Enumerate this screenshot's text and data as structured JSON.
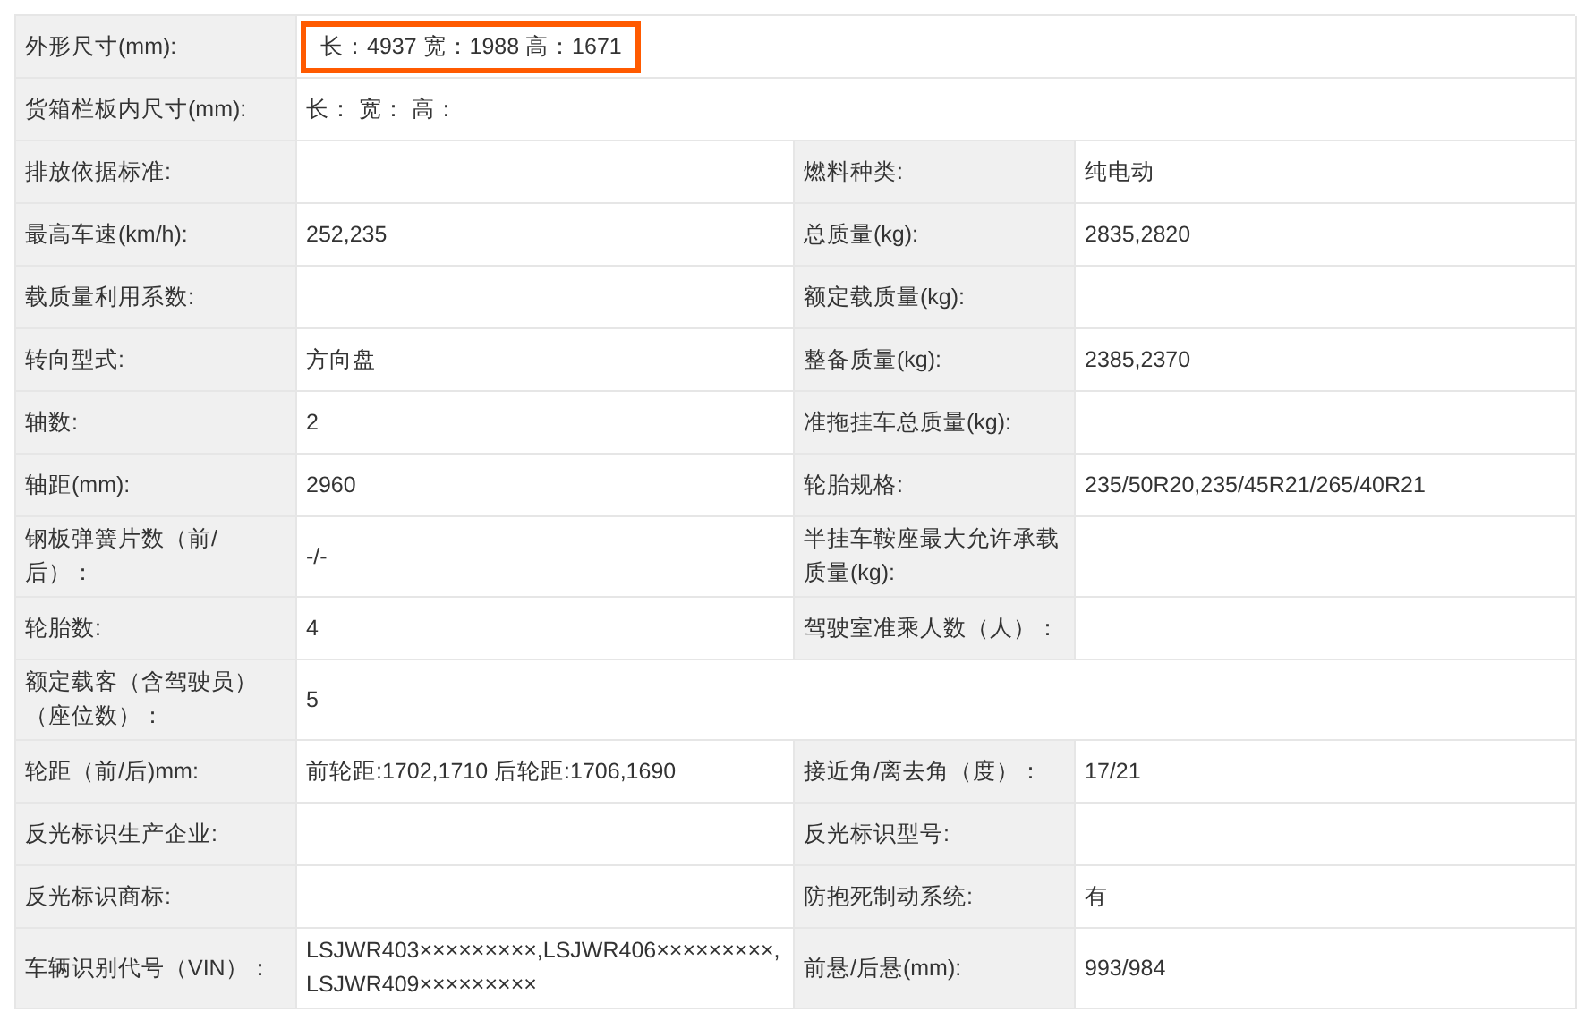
{
  "spec_table": {
    "rows": [
      {
        "fields": [
          {
            "label": "外形尺寸(mm):",
            "value": "长：4937 宽：1988 高：1671",
            "highlighted": true
          }
        ]
      },
      {
        "fields": [
          {
            "label": "货箱栏板内尺寸(mm):",
            "value": "长： 宽： 高：",
            "highlighted": false
          }
        ]
      },
      {
        "fields": [
          {
            "label": "排放依据标准:",
            "highlighted": false
          },
          {
            "label": "燃料种类:",
            "value": "纯电动",
            "highlighted": false
          }
        ]
      },
      {
        "fields": [
          {
            "label": "最高车速(km/h):",
            "value": "252,235",
            "highlighted": false
          },
          {
            "label": "总质量(kg):",
            "value": "2835,2820",
            "highlighted": false
          }
        ]
      },
      {
        "fields": [
          {
            "label": "载质量利用系数:",
            "highlighted": false
          },
          {
            "label": "额定载质量(kg):",
            "highlighted": false
          }
        ]
      },
      {
        "fields": [
          {
            "label": "转向型式:",
            "value": "方向盘",
            "highlighted": false
          },
          {
            "label": "整备质量(kg):",
            "value": "2385,2370",
            "highlighted": false
          }
        ]
      },
      {
        "fields": [
          {
            "label": "轴数:",
            "value": "2",
            "highlighted": false
          },
          {
            "label": "准拖挂车总质量(kg):",
            "highlighted": false
          }
        ]
      },
      {
        "fields": [
          {
            "label": "轴距(mm):",
            "value": "2960",
            "highlighted": false
          },
          {
            "label": "轮胎规格:",
            "value": "235/50R20,235/45R21/265/40R21",
            "highlighted": false
          }
        ]
      },
      {
        "fields": [
          {
            "label": "钢板弹簧片数（前/后）：",
            "value": "-/-",
            "highlighted": false
          },
          {
            "label": "半挂车鞍座最大允许承载质量(kg):",
            "highlighted": false
          }
        ]
      },
      {
        "fields": [
          {
            "label": "轮胎数:",
            "value": "4",
            "highlighted": false
          },
          {
            "label": "驾驶室准乘人数（人）：",
            "highlighted": false
          }
        ]
      },
      {
        "fields": [
          {
            "label": "额定载客（含驾驶员）（座位数）：",
            "value": "5",
            "highlighted": false
          }
        ]
      },
      {
        "fields": [
          {
            "label": "轮距（前/后)mm:",
            "value": "前轮距:1702,1710 后轮距:1706,1690",
            "highlighted": false
          },
          {
            "label": "接近角/离去角（度）：",
            "value": "17/21",
            "highlighted": false
          }
        ]
      },
      {
        "fields": [
          {
            "label": "反光标识生产企业:",
            "highlighted": false
          },
          {
            "label": "反光标识型号:",
            "highlighted": false
          }
        ]
      },
      {
        "fields": [
          {
            "label": "反光标识商标:",
            "highlighted": false
          },
          {
            "label": "防抱死制动系统:",
            "value": "有",
            "highlighted": false
          }
        ]
      },
      {
        "fields": [
          {
            "label": "车辆识别代号（VIN）：",
            "value": "LSJWR403×××××××××,LSJWR406×××××××××,LSJWR409×××××××××",
            "highlighted": false
          },
          {
            "label": "前悬/后悬(mm):",
            "value": "993/984",
            "highlighted": false
          }
        ]
      }
    ]
  }
}
